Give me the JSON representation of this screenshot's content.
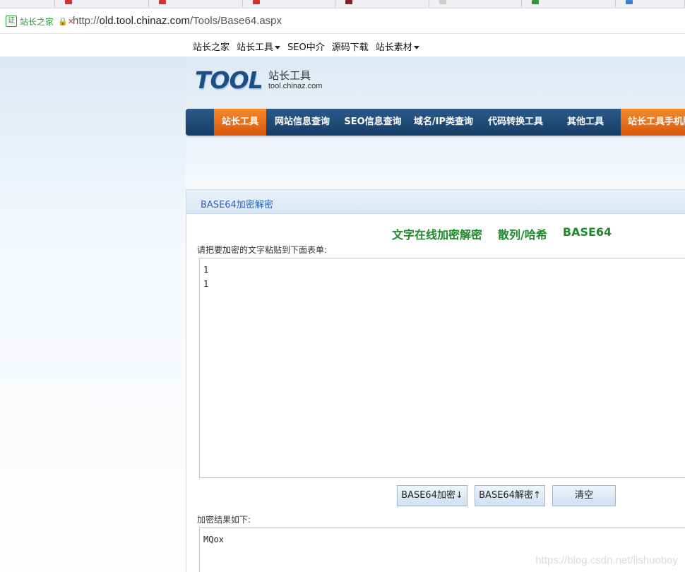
{
  "browser": {
    "tab_favicon_colors": [
      "#d22f2f",
      "#d22f2f",
      "#d22f2f",
      "#8a1f1f",
      "#cccccc",
      "#2b9a36",
      "#3d7bd9"
    ],
    "cert_label": "站长之家",
    "cert_icon_glyph": "证",
    "insecure_glyph": "🔒✕",
    "url_scheme": "http://",
    "url_host": "old.tool.chinaz.com",
    "url_path": "/Tools/Base64.aspx"
  },
  "topnav": {
    "items": [
      "站长之家",
      "站长工具",
      "SEO中介",
      "源码下载",
      "站长素材"
    ]
  },
  "logo": {
    "word": "TOOL",
    "cn": "站长工具",
    "domain": "tool.chinaz.com"
  },
  "mainnav": {
    "items": [
      "站长工具",
      "网站信息查询",
      "SEO信息查询",
      "域名/IP类查询",
      "代码转换工具",
      "其他工具",
      "站长工具手机版"
    ]
  },
  "panel": {
    "title": "BASE64加密解密",
    "subtitle": [
      "文字在线加密解密",
      "散列/哈希",
      "BASE64"
    ],
    "prompt_label": "请把要加密的文字粘贴到下面表单:",
    "input_value": "1\n1",
    "buttons": {
      "encode": "BASE64加密↓",
      "decode": "BASE64解密↑",
      "clear": "清空"
    },
    "result_label": "加密结果如下:",
    "output_value": "MQox"
  },
  "watermark": "https://blog.csdn.net/lishuoboy",
  "colors": {
    "nav_blue": "#1f4a78",
    "nav_orange": "#e8701c",
    "subtitle_green": "#1f8a2c",
    "title_blue": "#2f63b3"
  }
}
